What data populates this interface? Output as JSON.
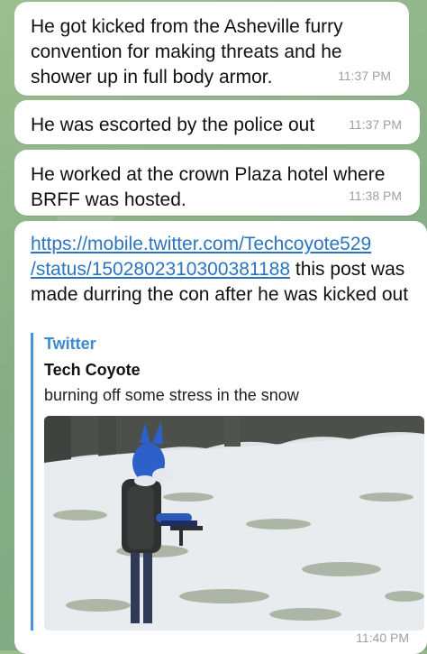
{
  "messages": [
    {
      "text": "He got kicked from the Asheville furry convention for making threats and he shower up in full body armor.",
      "time": "11:37 PM"
    },
    {
      "text": "He was escorted by the police out",
      "time": "11:37 PM"
    },
    {
      "text": "He worked at the crown Plaza hotel where BRFF was hosted.",
      "time": "11:38 PM"
    },
    {
      "link_line1": "https://mobile.twitter.com/Techcoyote529",
      "link_line2": "/status/1502802310300381188",
      "text_after_link": " this post was made durring the con after he was kicked out",
      "time": "11:40 PM",
      "preview": {
        "site": "Twitter",
        "title": "Tech Coyote",
        "description": "burning off some stress in the snow"
      }
    }
  ],
  "colors": {
    "background": "#8fb58c",
    "bubble": "#ffffff",
    "link": "#2b74c2",
    "preview_accent": "#4b93d6",
    "timestamp": "#9aa1a6"
  }
}
